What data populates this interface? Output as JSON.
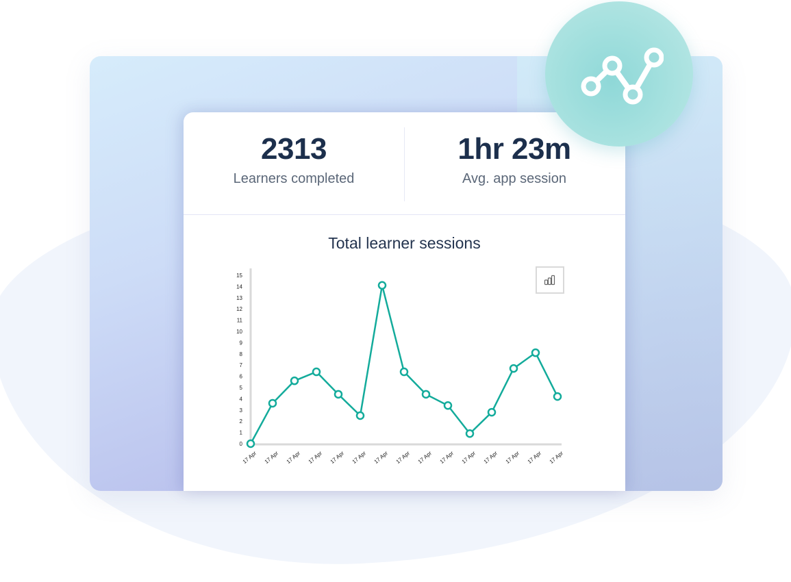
{
  "stats": {
    "learners_completed": {
      "value": "2313",
      "label": "Learners completed"
    },
    "avg_app_session": {
      "value": "1hr 23m",
      "label": "Avg. app session"
    }
  },
  "icons": {
    "badge": "line-chart-icon",
    "chart_toggle": "bar-chart-icon"
  },
  "colors": {
    "accent": "#13ab9b",
    "title": "#1c2f4c",
    "label": "#5b6778",
    "axis": "#d9d9d9"
  },
  "chart_data": {
    "type": "line",
    "title": "Total learner sessions",
    "xlabel": "",
    "ylabel": "",
    "ylim": [
      0,
      15
    ],
    "yticks": [
      0,
      1,
      2,
      3,
      4,
      5,
      6,
      7,
      8,
      9,
      10,
      11,
      12,
      13,
      14,
      15
    ],
    "categories": [
      "17 Apr",
      "17 Apr",
      "17 Apr",
      "17 Apr",
      "17 Apr",
      "17 Apr",
      "17 Apr",
      "17 Apr",
      "17 Apr",
      "17 Apr",
      "17 Apr",
      "17 Apr",
      "17 Apr",
      "17 Apr",
      "17 Apr"
    ],
    "series": [
      {
        "name": "Total learner sessions",
        "values": [
          0,
          3.6,
          5.6,
          6.4,
          4.4,
          2.5,
          14.1,
          6.4,
          4.4,
          3.4,
          0.9,
          2.8,
          6.7,
          8.1,
          4.2
        ]
      }
    ],
    "grid": false,
    "legend": "none"
  }
}
